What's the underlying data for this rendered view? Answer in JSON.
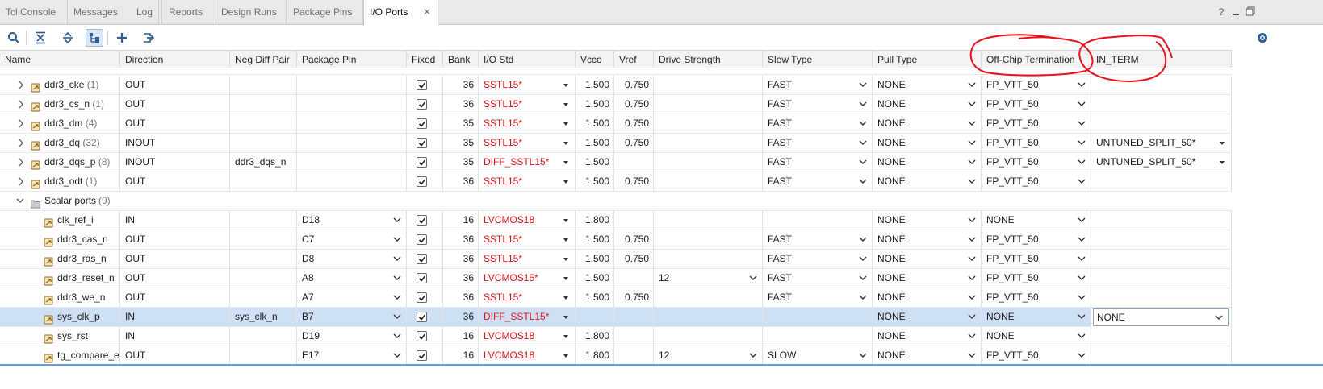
{
  "tabs": [
    {
      "label": "Tcl Console"
    },
    {
      "label": "Messages"
    },
    {
      "label": "Log"
    },
    {
      "label": "Reports"
    },
    {
      "label": "Design Runs"
    },
    {
      "label": "Package Pins"
    },
    {
      "label": "I/O Ports"
    }
  ],
  "tab_close_glyph": "✕",
  "help_glyph": "?",
  "columns": {
    "name": "Name",
    "direction": "Direction",
    "neg_diff_pair": "Neg Diff Pair",
    "package_pin": "Package Pin",
    "fixed": "Fixed",
    "bank": "Bank",
    "io_std": "I/O Std",
    "vcco": "Vcco",
    "vref": "Vref",
    "drive_strength": "Drive Strength",
    "slew_type": "Slew Type",
    "pull_type": "Pull Type",
    "off_chip_termination": "Off-Chip Termination",
    "in_term": "IN_TERM"
  },
  "rows": [
    {
      "name": "ddr3_cke",
      "count": "(1)",
      "direction": "OUT",
      "neg_diff_pair": "",
      "package_pin": "",
      "bank": "36",
      "io_std": "SSTL15*",
      "vcco": "1.500",
      "vref": "0.750",
      "drive_strength": "",
      "slew_type": "FAST",
      "pull_type": "NONE",
      "off_chip_termination": "FP_VTT_50",
      "in_term": ""
    },
    {
      "name": "ddr3_cs_n",
      "count": "(1)",
      "direction": "OUT",
      "neg_diff_pair": "",
      "package_pin": "",
      "bank": "36",
      "io_std": "SSTL15*",
      "vcco": "1.500",
      "vref": "0.750",
      "drive_strength": "",
      "slew_type": "FAST",
      "pull_type": "NONE",
      "off_chip_termination": "FP_VTT_50",
      "in_term": ""
    },
    {
      "name": "ddr3_dm",
      "count": "(4)",
      "direction": "OUT",
      "neg_diff_pair": "",
      "package_pin": "",
      "bank": "35",
      "io_std": "SSTL15*",
      "vcco": "1.500",
      "vref": "0.750",
      "drive_strength": "",
      "slew_type": "FAST",
      "pull_type": "NONE",
      "off_chip_termination": "FP_VTT_50",
      "in_term": ""
    },
    {
      "name": "ddr3_dq",
      "count": "(32)",
      "direction": "INOUT",
      "neg_diff_pair": "",
      "package_pin": "",
      "bank": "35",
      "io_std": "SSTL15*",
      "vcco": "1.500",
      "vref": "0.750",
      "drive_strength": "",
      "slew_type": "FAST",
      "pull_type": "NONE",
      "off_chip_termination": "FP_VTT_50",
      "in_term": "UNTUNED_SPLIT_50*"
    },
    {
      "name": "ddr3_dqs_p",
      "count": "(8)",
      "direction": "INOUT",
      "neg_diff_pair": "ddr3_dqs_n",
      "package_pin": "",
      "bank": "35",
      "io_std": "DIFF_SSTL15*",
      "vcco": "1.500",
      "vref": "",
      "drive_strength": "",
      "slew_type": "FAST",
      "pull_type": "NONE",
      "off_chip_termination": "FP_VTT_50",
      "in_term": "UNTUNED_SPLIT_50*"
    },
    {
      "name": "ddr3_odt",
      "count": "(1)",
      "direction": "OUT",
      "neg_diff_pair": "",
      "package_pin": "",
      "bank": "36",
      "io_std": "SSTL15*",
      "vcco": "1.500",
      "vref": "0.750",
      "drive_strength": "",
      "slew_type": "FAST",
      "pull_type": "NONE",
      "off_chip_termination": "FP_VTT_50",
      "in_term": ""
    },
    {
      "group": true,
      "name": "Scalar ports",
      "count": "(9)"
    },
    {
      "name": "clk_ref_i",
      "direction": "IN",
      "neg_diff_pair": "",
      "package_pin": "D18",
      "bank": "16",
      "io_std": "LVCMOS18",
      "vcco": "1.800",
      "vref": "",
      "drive_strength": "",
      "slew_type": "",
      "pull_type": "NONE",
      "off_chip_termination": "NONE",
      "in_term": ""
    },
    {
      "name": "ddr3_cas_n",
      "direction": "OUT",
      "neg_diff_pair": "",
      "package_pin": "C7",
      "bank": "36",
      "io_std": "SSTL15*",
      "vcco": "1.500",
      "vref": "0.750",
      "drive_strength": "",
      "slew_type": "FAST",
      "pull_type": "NONE",
      "off_chip_termination": "FP_VTT_50",
      "in_term": ""
    },
    {
      "name": "ddr3_ras_n",
      "direction": "OUT",
      "neg_diff_pair": "",
      "package_pin": "D8",
      "bank": "36",
      "io_std": "SSTL15*",
      "vcco": "1.500",
      "vref": "0.750",
      "drive_strength": "",
      "slew_type": "FAST",
      "pull_type": "NONE",
      "off_chip_termination": "FP_VTT_50",
      "in_term": ""
    },
    {
      "name": "ddr3_reset_n",
      "direction": "OUT",
      "neg_diff_pair": "",
      "package_pin": "A8",
      "bank": "36",
      "io_std": "LVCMOS15*",
      "vcco": "1.500",
      "vref": "",
      "drive_strength": "12",
      "slew_type": "FAST",
      "pull_type": "NONE",
      "off_chip_termination": "FP_VTT_50",
      "in_term": ""
    },
    {
      "name": "ddr3_we_n",
      "direction": "OUT",
      "neg_diff_pair": "",
      "package_pin": "A7",
      "bank": "36",
      "io_std": "SSTL15*",
      "vcco": "1.500",
      "vref": "0.750",
      "drive_strength": "",
      "slew_type": "FAST",
      "pull_type": "NONE",
      "off_chip_termination": "FP_VTT_50",
      "in_term": ""
    },
    {
      "name": "sys_clk_p",
      "direction": "IN",
      "neg_diff_pair": "sys_clk_n",
      "package_pin": "B7",
      "bank": "36",
      "io_std": "DIFF_SSTL15*",
      "vcco": "",
      "vref": "",
      "drive_strength": "",
      "slew_type": "",
      "pull_type": "NONE",
      "off_chip_termination": "NONE",
      "in_term": "NONE",
      "selected": true
    },
    {
      "name": "sys_rst",
      "direction": "IN",
      "neg_diff_pair": "",
      "package_pin": "D19",
      "bank": "16",
      "io_std": "LVCMOS18",
      "vcco": "1.800",
      "vref": "",
      "drive_strength": "",
      "slew_type": "",
      "pull_type": "NONE",
      "off_chip_termination": "NONE",
      "in_term": ""
    },
    {
      "name": "tg_compare_e",
      "direction": "OUT",
      "neg_diff_pair": "",
      "package_pin": "E17",
      "bank": "16",
      "io_std": "LVCMOS18",
      "vcco": "1.800",
      "vref": "",
      "drive_strength": "12",
      "slew_type": "SLOW",
      "pull_type": "NONE",
      "off_chip_termination": "FP_VTT_50",
      "in_term": ""
    }
  ],
  "icons": {
    "search": "search-icon",
    "collapse_all": "collapse-all-icon",
    "expand_all": "expand-all-icon",
    "group_by": "group-by-interface-icon",
    "add": "add-icon",
    "export": "export-icon",
    "settings": "gear-icon"
  },
  "colors": {
    "accent_blue": "#6f9bd3",
    "selection": "#cfe0f5",
    "error_red": "#e0141c",
    "annotation_red": "#e8101a"
  }
}
